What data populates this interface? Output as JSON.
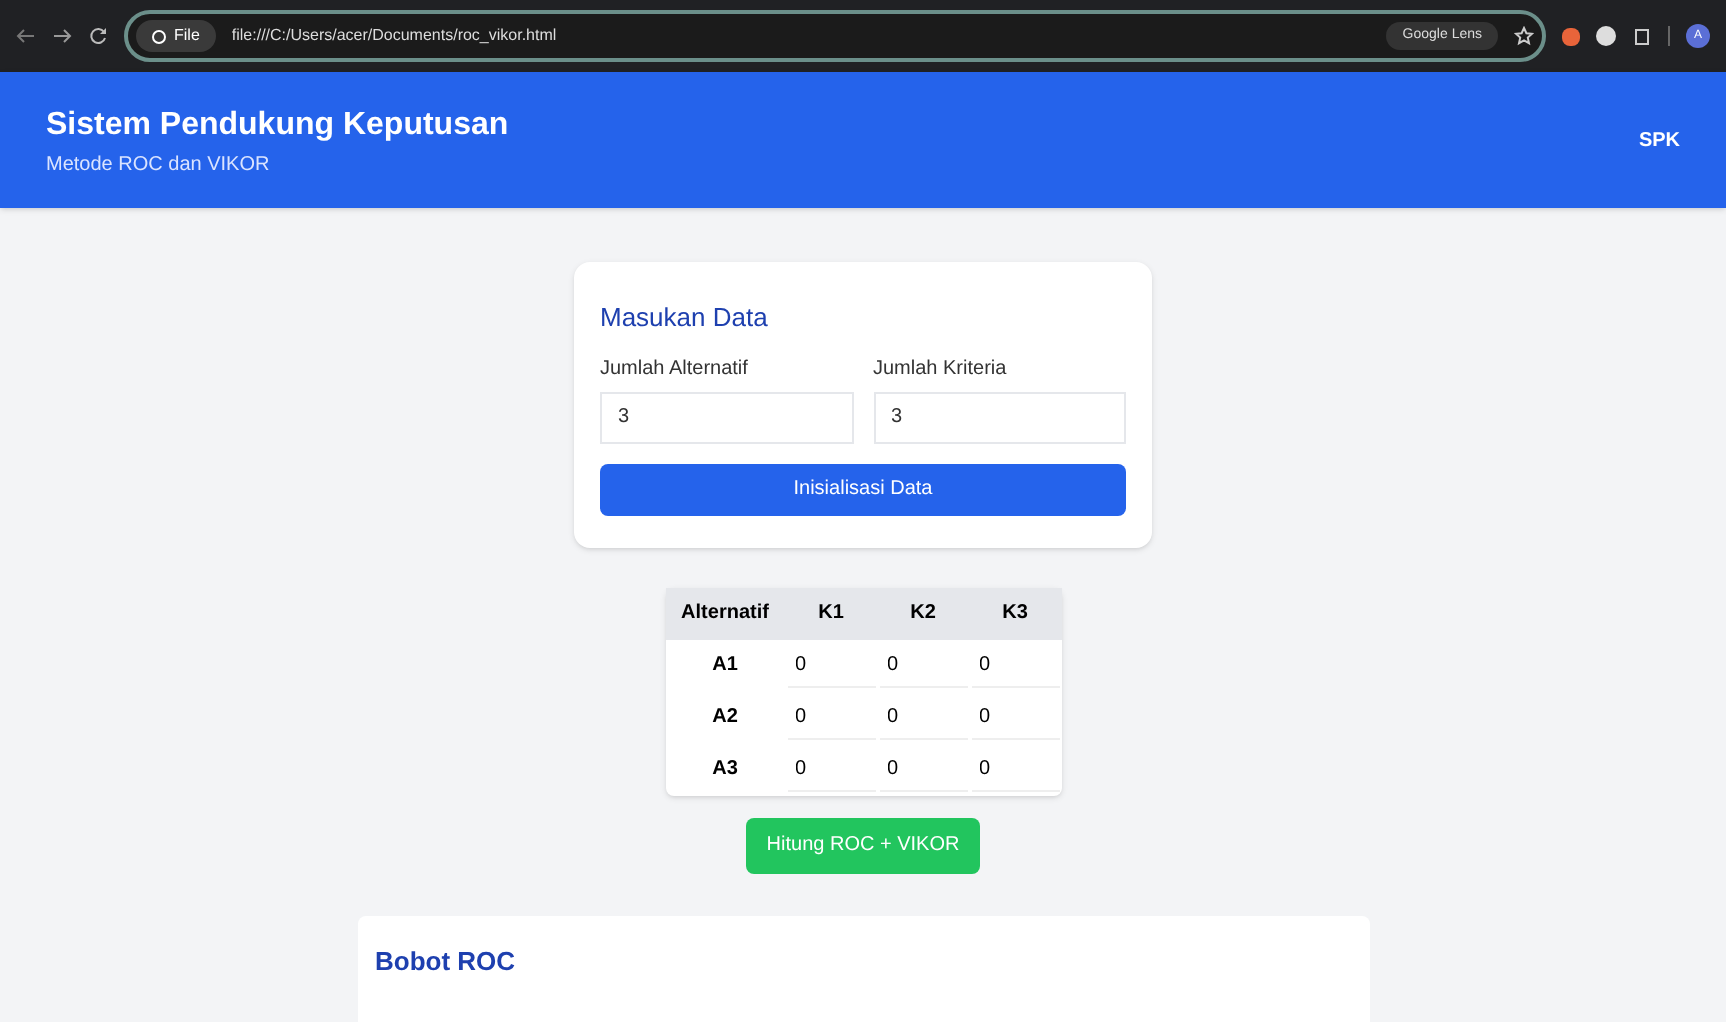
{
  "browser": {
    "chip": "File",
    "url": "file:///C:/Users/acer/Documents/roc_vikor.html",
    "lens": "Google Lens",
    "avatar": "A"
  },
  "header": {
    "title": "Sistem Pendukung Keputusan",
    "subtitle": "Metode ROC dan VIKOR",
    "brand": "SPK"
  },
  "input_card": {
    "title": "Masukan Data",
    "fields": [
      {
        "label": "Jumlah Alternatif",
        "value": "3"
      },
      {
        "label": "Jumlah Kriteria",
        "value": "3"
      }
    ],
    "button": "Inisialisasi Data"
  },
  "table": {
    "columns": [
      "Alternatif",
      "K1",
      "K2",
      "K3"
    ],
    "rows": [
      {
        "name": "A1",
        "values": [
          "0",
          "0",
          "0"
        ]
      },
      {
        "name": "A2",
        "values": [
          "0",
          "0",
          "0"
        ]
      },
      {
        "name": "A3",
        "values": [
          "0",
          "0",
          "0"
        ]
      }
    ]
  },
  "compute_button": "Hitung ROC + VIKOR",
  "result_card": {
    "title": "Bobot ROC"
  }
}
